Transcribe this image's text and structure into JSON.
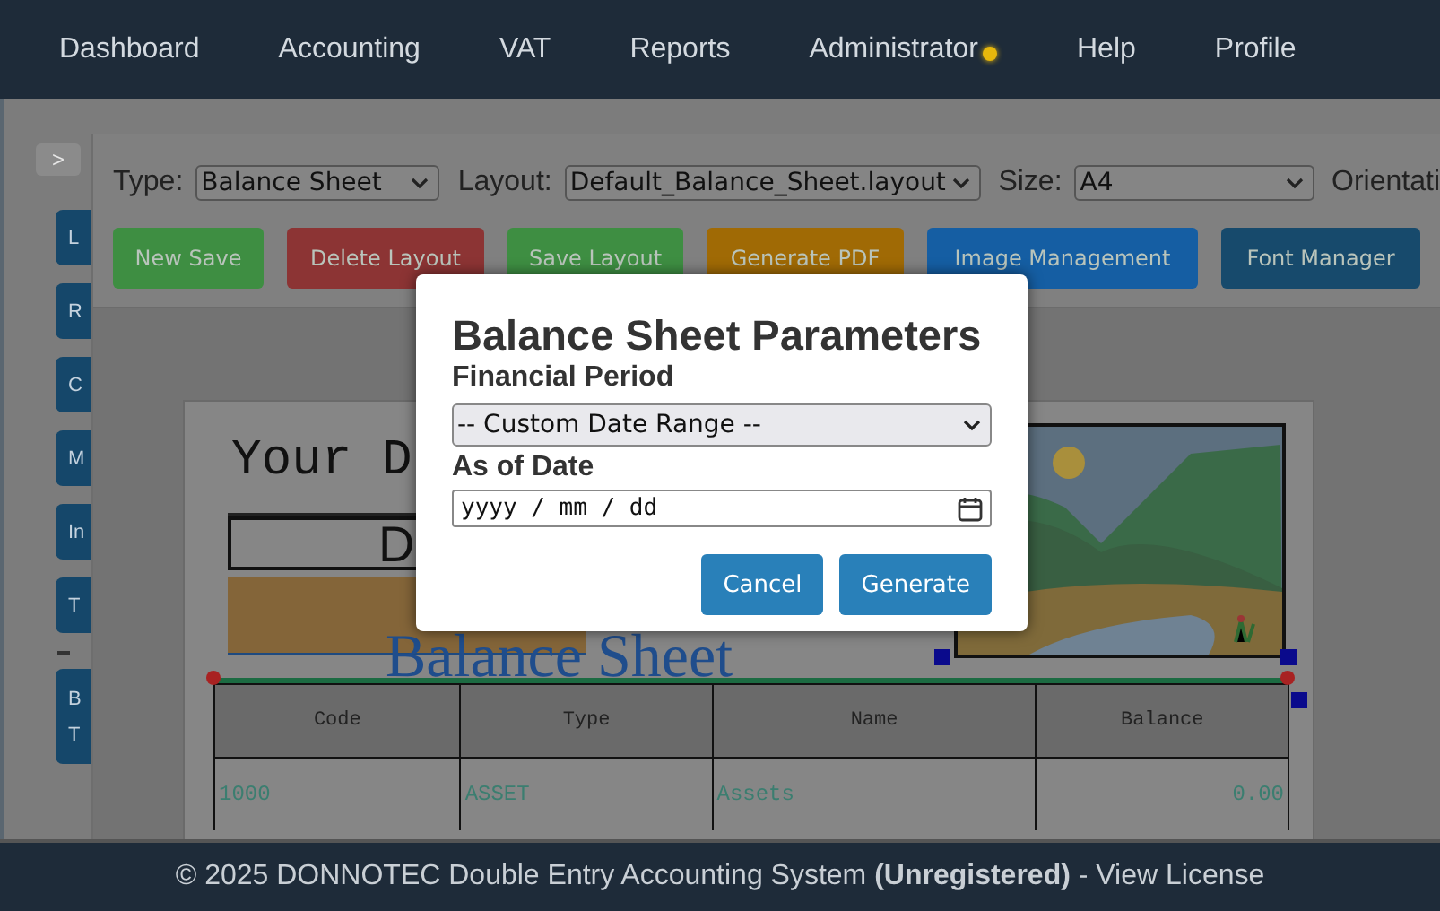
{
  "nav": {
    "items": [
      {
        "label": "Dashboard",
        "notification": false
      },
      {
        "label": "Accounting",
        "notification": false
      },
      {
        "label": "VAT",
        "notification": false
      },
      {
        "label": "Reports",
        "notification": false
      },
      {
        "label": "Administrator",
        "notification": true
      },
      {
        "label": "Help",
        "notification": false
      },
      {
        "label": "Profile",
        "notification": false
      }
    ]
  },
  "sidebar": {
    "toggle": ">",
    "items": [
      "L",
      "R",
      "C",
      "M",
      "In",
      "T",
      "B T"
    ]
  },
  "toolbar": {
    "fields": [
      {
        "label": "Type:",
        "value": "Balance Sheet"
      },
      {
        "label": "Layout:",
        "value": "Default_Balance_Sheet.layout"
      },
      {
        "label": "Size:",
        "value": "A4"
      }
    ],
    "trailing_label": "Orientati",
    "buttons": [
      {
        "label": "New Save",
        "color": "#3e8e42"
      },
      {
        "label": "Delete Layout",
        "color": "#8c3434"
      },
      {
        "label": "Save Layout",
        "color": "#3e8e42"
      },
      {
        "label": "Generate PDF",
        "color": "#a06a05"
      },
      {
        "label": "Image Management",
        "color": "#155ea3"
      },
      {
        "label": "Font Manager",
        "color": "#174a6c"
      }
    ]
  },
  "canvas": {
    "header_text": "Your D",
    "box_text": "D",
    "title": "Balance Sheet",
    "table": {
      "columns": [
        "Code",
        "Type",
        "Name",
        "Balance"
      ],
      "rows": [
        [
          "1000",
          "ASSET",
          "Assets",
          "0.00"
        ]
      ]
    }
  },
  "dialog": {
    "title": "Balance Sheet Parameters",
    "period": {
      "label": "Financial Period",
      "value": "-- Custom Date Range --"
    },
    "date": {
      "label": "As of Date",
      "placeholder": "yyyy / mm / dd"
    },
    "buttons": [
      "Cancel",
      "Generate"
    ]
  },
  "footer": {
    "text": "© 2025 DONNOTEC Double Entry Accounting System **(Unregistered)** - View License"
  }
}
